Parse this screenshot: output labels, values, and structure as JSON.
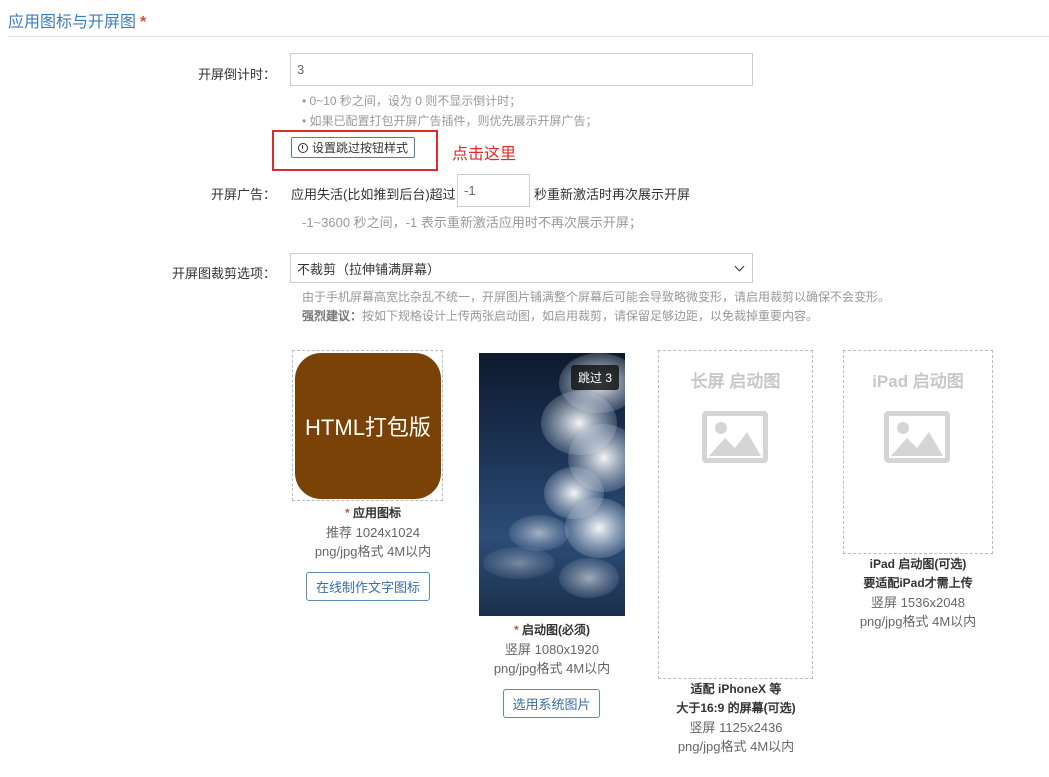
{
  "section": {
    "title": "应用图标与开屏图",
    "required_mark": "*"
  },
  "countdown": {
    "label": "开屏倒计时：",
    "value": "3",
    "hints": [
      "• 0~10 秒之间，设为 0 则不显示倒计时；",
      "• 如果已配置打包开屏广告插件，则优先展示开屏广告；"
    ],
    "skip_button": "设置跳过按钮样式",
    "annotation": "点击这里"
  },
  "ad": {
    "label": "开屏广告：",
    "prefix": "应用失活(比如推到后台)超过",
    "value": "-1",
    "suffix": "秒重新激活时再次展示开屏",
    "hint": "-1~3600 秒之间，-1 表示重新激活应用时不再次展示开屏；"
  },
  "crop": {
    "label": "开屏图裁剪选项：",
    "selected": "不裁剪（拉伸铺满屏幕）",
    "hint1": "由于手机屏幕高宽比杂乱不统一，开屏图片铺满整个屏幕后可能会导致略微变形，请启用裁剪以确保不会变形。",
    "hint2_bold": "强烈建议：",
    "hint2": "按如下规格设计上传两张启动图，如启用裁剪，请保留足够边距，以免裁掉重要内容。"
  },
  "cards": {
    "app_icon": {
      "image_text": "HTML打包版",
      "color": "#7a4207",
      "star": "*",
      "title": "应用图标",
      "size": "推荐 1024x1024",
      "format": "png/jpg格式 4M以内",
      "button": "在线制作文字图标"
    },
    "splash": {
      "skip_badge": "跳过 3",
      "star": "*",
      "title": "启动图(必须)",
      "size": "竖屏 1080x1920",
      "format": "png/jpg格式 4M以内",
      "button": "选用系统图片"
    },
    "long_splash": {
      "placeholder": "长屏 启动图",
      "title1": "适配 iPhoneX 等",
      "title2": "大于16:9 的屏幕(可选)",
      "size": "竖屏 1125x2436",
      "format": "png/jpg格式 4M以内"
    },
    "ipad_splash": {
      "placeholder": "iPad 启动图",
      "title1": "iPad 启动图(可选)",
      "title2": "要适配iPad才需上传",
      "size": "竖屏 1536x2048",
      "format": "png/jpg格式 4M以内"
    }
  }
}
